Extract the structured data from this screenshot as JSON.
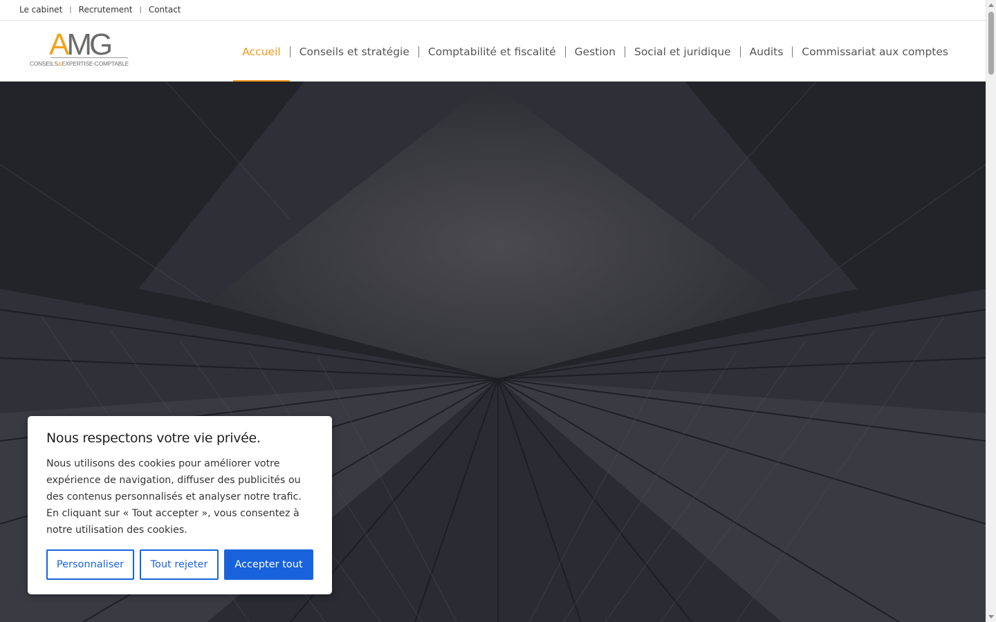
{
  "topbar": {
    "links": [
      "Le cabinet",
      "Recrutement",
      "Contact"
    ],
    "separator": "|"
  },
  "logo": {
    "letter_a": "A",
    "letters_mg": "MG",
    "tagline_part1": "CONSEILS",
    "tagline_amp": "&",
    "tagline_part2": "EXPERTISE-COMPTABLE"
  },
  "nav": {
    "items": [
      "Accueil",
      "Conseils et stratégie",
      "Comptabilité et fiscalité",
      "Gestion",
      "Social et juridique",
      "Audits",
      "Commissariat aux comptes"
    ],
    "active": "Accueil"
  },
  "cookie": {
    "title": "Nous respectons votre vie privée.",
    "text": "Nous utilisons des cookies pour améliorer votre expérience de navigation, diffuser des publicités ou des contenus personnalisés et analyser notre trafic. En cliquant sur « Tout accepter », vous consentez à notre utilisation des cookies.",
    "customize_label": "Personnaliser",
    "reject_label": "Tout rejeter",
    "accept_label": "Accepter tout"
  },
  "colors": {
    "accent": "#f2961b",
    "button_blue": "#1863dc",
    "hero_dark": "#2a2b31"
  }
}
